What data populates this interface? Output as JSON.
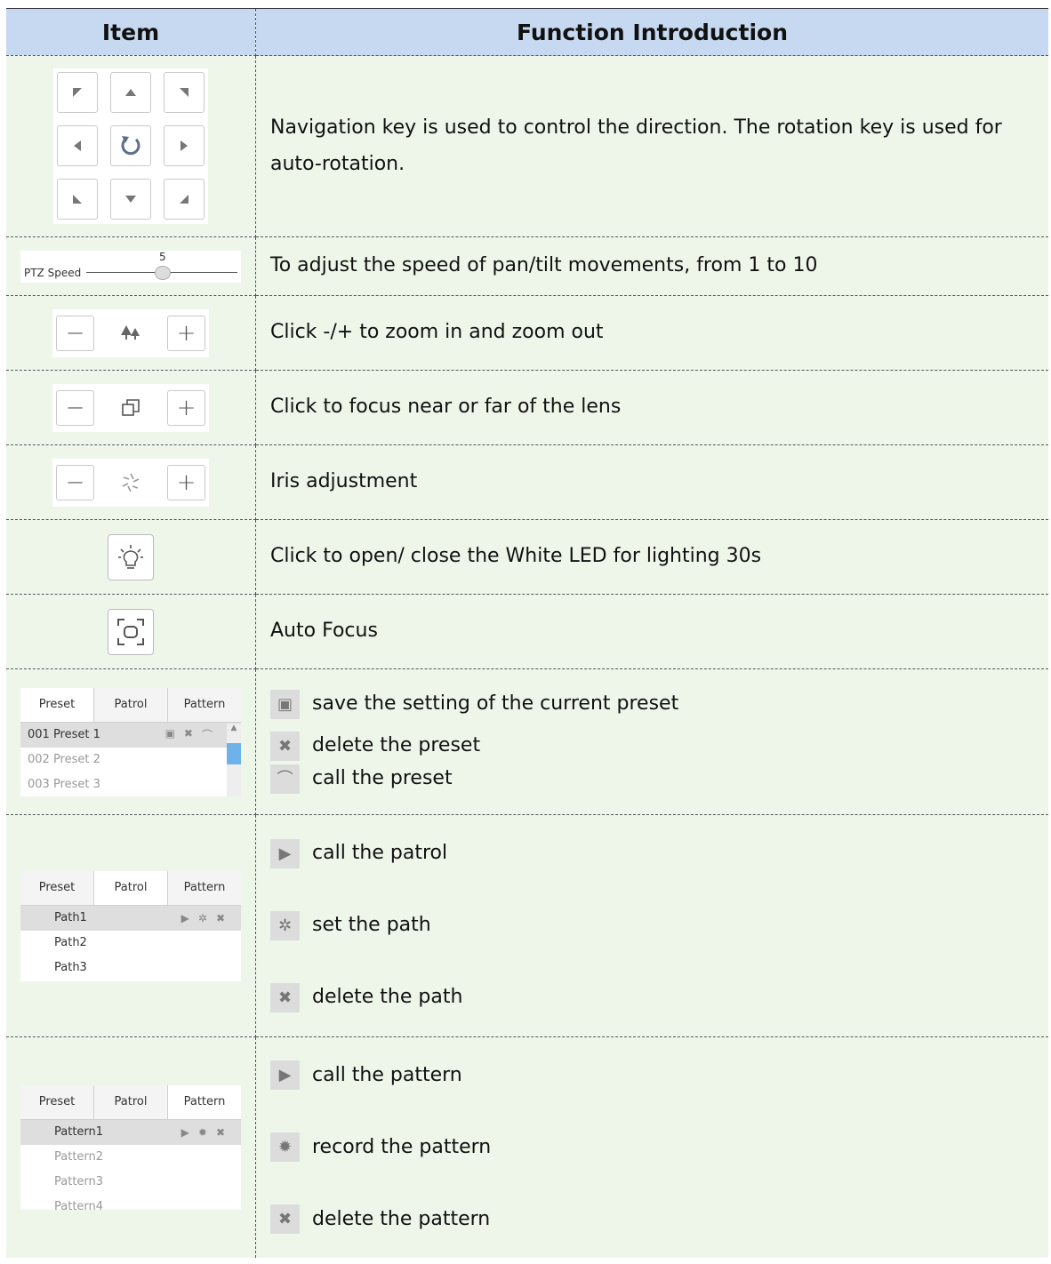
{
  "header": {
    "item": "Item",
    "function": "Function Introduction"
  },
  "rows": {
    "navigation": {
      "text": "Navigation key is used to control the direction. The rotation key is used for auto-rotation."
    },
    "speed": {
      "label": "PTZ Speed",
      "value": "5",
      "value_fraction": 0.5,
      "text": "To adjust the speed of pan/tilt movements, from 1 to 10"
    },
    "zoom": {
      "text": "Click -/+ to zoom in and zoom out"
    },
    "focus": {
      "text": "Click to focus near or far of the lens"
    },
    "iris": {
      "text": "Iris adjustment"
    },
    "led": {
      "text": "Click to open/ close the White LED for lighting 30s"
    },
    "autofocus": {
      "text": "Auto Focus"
    },
    "preset": {
      "tabs": [
        "Preset",
        "Patrol",
        "Pattern"
      ],
      "items": [
        "001  Preset 1",
        "002  Preset 2",
        "003  Preset 3"
      ],
      "lines": [
        "save the setting of the current preset",
        "delete the preset",
        "call the preset"
      ]
    },
    "patrol": {
      "tabs": [
        "Preset",
        "Patrol",
        "Pattern"
      ],
      "items": [
        "Path1",
        "Path2",
        "Path3"
      ],
      "lines": [
        "call the patrol",
        "set the path",
        "delete the path"
      ]
    },
    "pattern": {
      "tabs": [
        "Preset",
        "Patrol",
        "Pattern"
      ],
      "items": [
        "Pattern1",
        "Pattern2",
        "Pattern3",
        "Pattern4"
      ],
      "lines": [
        "call the pattern",
        "record the pattern",
        "delete the pattern"
      ]
    }
  },
  "icons": [
    "arrow-up-left-icon",
    "arrow-up-icon",
    "arrow-up-right-icon",
    "arrow-left-icon",
    "rotate-icon",
    "arrow-right-icon",
    "arrow-down-left-icon",
    "arrow-down-icon",
    "arrow-down-right-icon",
    "minus-icon",
    "plus-icon",
    "trees-icon",
    "focus-squares-icon",
    "iris-icon",
    "bulb-icon",
    "autofocus-icon",
    "save-icon",
    "delete-icon",
    "call-icon",
    "play-icon",
    "gear-icon",
    "record-icon"
  ],
  "colors": {
    "header_bg": "#c6d9f0",
    "row_bg": "#eef6e9",
    "scroll_thumb": "#6fb2ea"
  }
}
